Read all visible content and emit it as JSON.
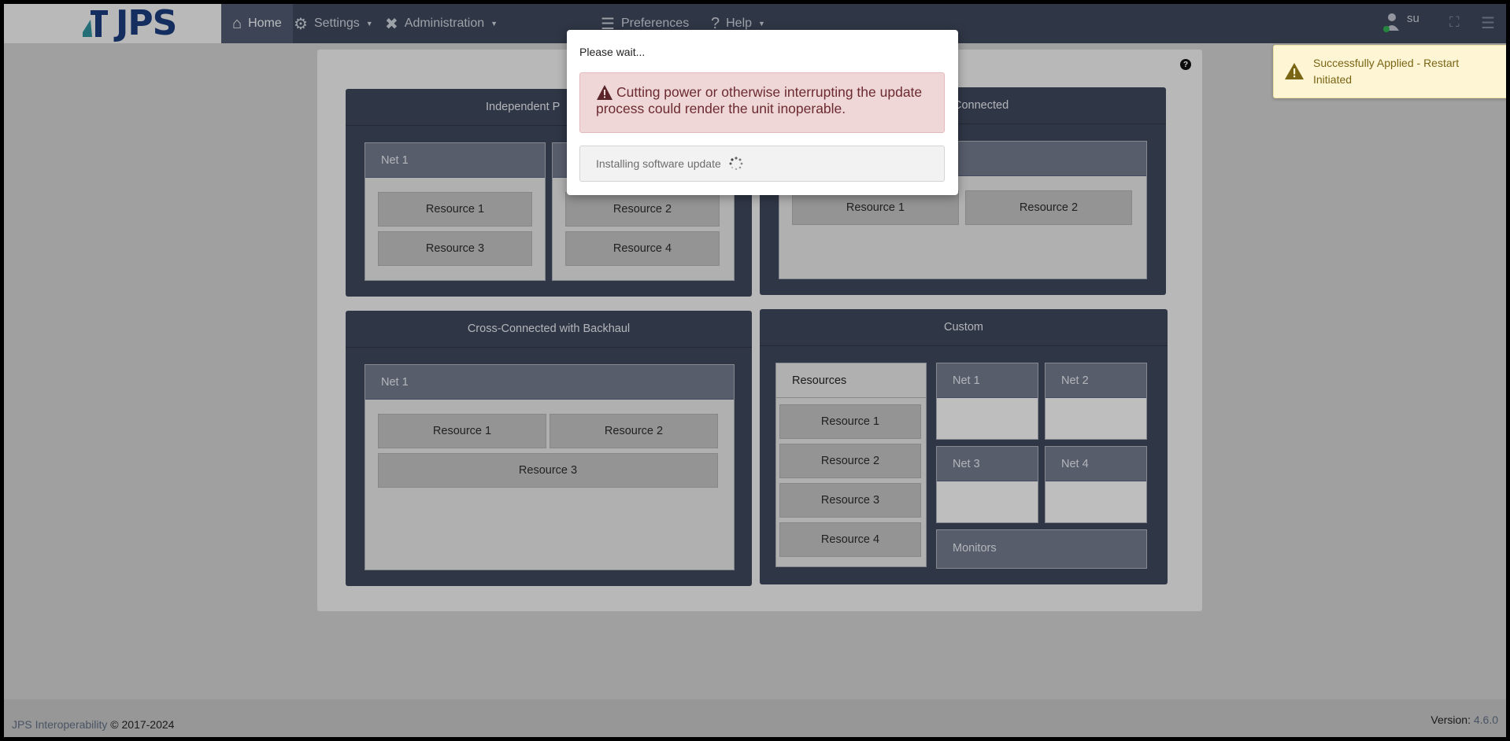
{
  "brand": {
    "name": "JPS"
  },
  "nav": {
    "home": "Home",
    "settings": "Settings",
    "administration": "Administration",
    "preferences": "Preferences",
    "help": "Help"
  },
  "user": {
    "name": "su"
  },
  "panels": {
    "independent": {
      "title": "Independent P",
      "net1": {
        "label": "Net 1",
        "resources": [
          "Resource 1",
          "Resource 3"
        ]
      },
      "net2": {
        "resources": [
          "Resource 2",
          "Resource 4"
        ]
      }
    },
    "cross_connected": {
      "title": "Connected",
      "resources": [
        "Resource 1",
        "Resource 2"
      ]
    },
    "backhaul": {
      "title": "Cross-Connected with Backhaul",
      "net1": {
        "label": "Net 1",
        "resources": [
          "Resource 1",
          "Resource 2",
          "Resource 3"
        ]
      }
    },
    "custom": {
      "title": "Custom",
      "resources_label": "Resources",
      "resources": [
        "Resource 1",
        "Resource 2",
        "Resource 3",
        "Resource 4"
      ],
      "nets": [
        "Net 1",
        "Net 2",
        "Net 3",
        "Net 4"
      ],
      "monitors": "Monitors"
    }
  },
  "modal": {
    "title": "Please wait...",
    "warning": "Cutting power or otherwise interrupting the update process could render the unit inoperable.",
    "status": "Installing software update"
  },
  "toast": {
    "message": "Successfully Applied - Restart Initiated"
  },
  "footer": {
    "company": "JPS Interoperability",
    "years": "© 2017-2024",
    "version_label": "Version:",
    "version": "4.6.0"
  },
  "colors": {
    "navbar": "#3b4457",
    "warning_bg": "#efd7d8",
    "warning_text": "#6b2a30",
    "toast_bg": "#fdf5d4",
    "toast_text": "#7a6515"
  }
}
